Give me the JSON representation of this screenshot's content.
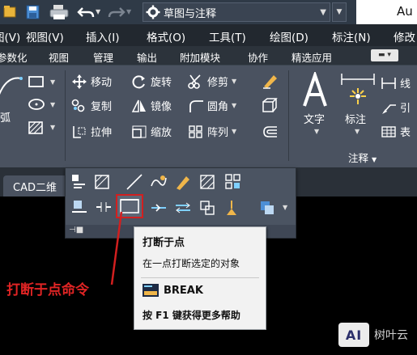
{
  "quick_access": {
    "workspace": "草图与注释",
    "app_title": "Au"
  },
  "menubar": {
    "items": [
      "图(V)",
      "视图(V)",
      "插入(I)",
      "格式(O)",
      "工具(T)",
      "绘图(D)",
      "标注(N)",
      "修改"
    ]
  },
  "ribbon_tabs": {
    "items": [
      "参数化",
      "视图",
      "管理",
      "输出",
      "附加模块",
      "协作",
      "精选应用"
    ]
  },
  "ribbon": {
    "draw": {
      "arc_label": "弧"
    },
    "modify": {
      "move": "移动",
      "rotate": "旋转",
      "trim": "修剪",
      "copy": "复制",
      "mirror": "镜像",
      "fillet": "圆角",
      "stretch": "拉伸",
      "scale": "缩放",
      "array": "阵列"
    },
    "annotation": {
      "text": "文字",
      "dimension": "标注",
      "panel_title": "注释",
      "linear": "线",
      "leader": "引",
      "table": "表"
    }
  },
  "doc_tab": {
    "label": "CAD二维"
  },
  "tooltip": {
    "title": "打断于点",
    "description": "在一点打断选定的对象",
    "command": "BREAK",
    "help": "按 F1 键获得更多帮助"
  },
  "annotation": {
    "label": "打断于点命令",
    "color": "#e02424"
  },
  "watermark": {
    "logo": "AI",
    "brand": "树叶云"
  },
  "colors": {
    "ribbon_bg": "#4a5260",
    "menubar_bg": "#22282f",
    "highlight": "#d21f1f"
  }
}
